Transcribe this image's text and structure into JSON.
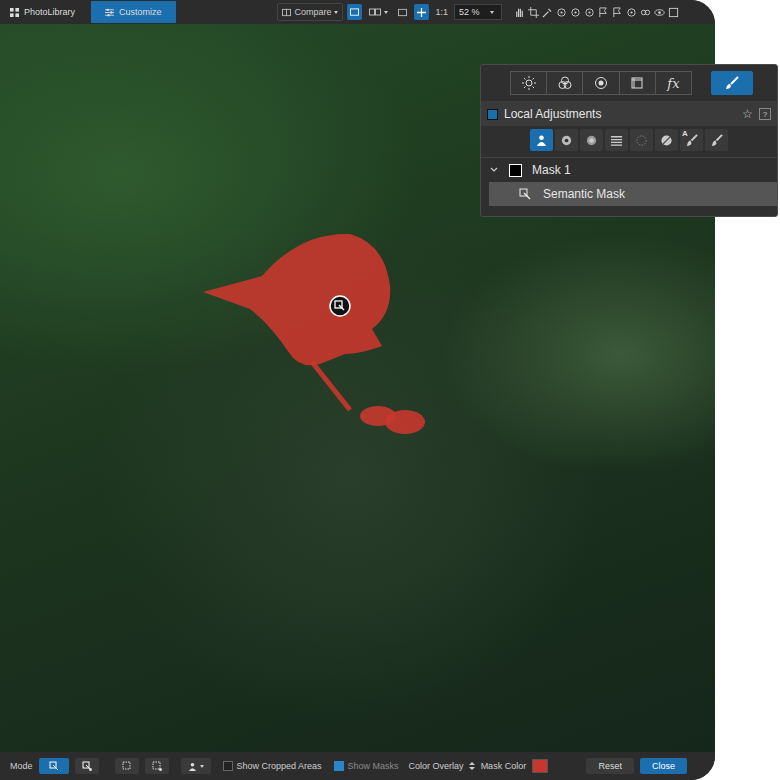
{
  "top_bar": {
    "tabs": [
      {
        "label": "PhotoLibrary",
        "selected": false
      },
      {
        "label": "Customize",
        "selected": true
      }
    ],
    "compare": "Compare",
    "zoom_ratio": "1:1",
    "zoom": "52 %"
  },
  "viewer": {
    "mask_overlay": true
  },
  "panel": {
    "palettes": [
      {
        "kind": "light",
        "text": "",
        "selected": false
      },
      {
        "kind": "color",
        "text": "",
        "selected": false
      },
      {
        "kind": "detail",
        "text": "",
        "selected": false
      },
      {
        "kind": "geometry",
        "text": "",
        "selected": false
      },
      {
        "kind": "effects",
        "text": "fx",
        "selected": false
      },
      {
        "kind": "local",
        "text": "",
        "selected": true
      }
    ],
    "title": "Local Adjustments",
    "star": "☆",
    "help": "?",
    "tools": [
      {
        "kind": "semantic",
        "text": "",
        "selected": true
      },
      {
        "kind": "control-point",
        "text": "",
        "selected": false
      },
      {
        "kind": "control-line",
        "text": "",
        "selected": false
      },
      {
        "kind": "gradient",
        "text": "",
        "selected": false
      },
      {
        "kind": "auto-mask",
        "text": "",
        "selected": false
      },
      {
        "kind": "eraser",
        "text": "",
        "selected": false
      },
      {
        "kind": "auto-brush",
        "text": "A",
        "selected": false
      },
      {
        "kind": "brush",
        "text": "",
        "selected": false
      }
    ],
    "masks": [
      {
        "name": "Mask 1",
        "expanded": true,
        "checked": false,
        "children": [
          {
            "name": "Semantic Mask",
            "selected": true
          }
        ]
      }
    ]
  },
  "bottom_bar": {
    "mode_label": "Mode",
    "modes": [
      {
        "kind": "semantic",
        "selected": true
      },
      {
        "kind": "semantic-add",
        "selected": false
      },
      {
        "kind": "select",
        "selected": false
      },
      {
        "kind": "select-sub",
        "selected": false
      }
    ],
    "checkboxes": [
      {
        "label": "Show Cropped Areas",
        "checked": false,
        "disabled": false
      },
      {
        "label": "Show Masks",
        "checked": true,
        "disabled": true
      }
    ],
    "overlay_mode": "Color Overlay",
    "mask_color_label": "Mask Color",
    "mask_color": "#c8372d",
    "buttons": [
      {
        "label": "Reset",
        "primary": false
      },
      {
        "label": "Close",
        "primary": true
      }
    ]
  }
}
